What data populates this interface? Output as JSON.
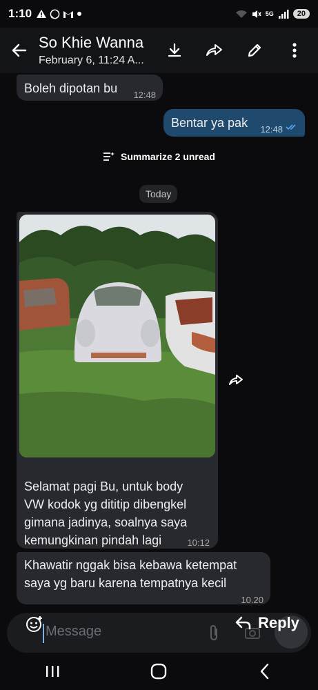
{
  "status_bar": {
    "time": "1:10",
    "network": "5G",
    "battery": "20"
  },
  "header": {
    "contact_name": "So Khie Wanna",
    "subtitle": "February 6, 11:24 A..."
  },
  "messages": {
    "m1": {
      "text": "Boleh dipotan bu",
      "time": "12:48"
    },
    "m2": {
      "text": "Bentar ya pak",
      "time": "12:48"
    },
    "summarize_label": "Summarize 2 unread",
    "date_divider": "Today",
    "m3": {
      "caption_lines": [
        "Selamat pagi Bu, untuk body",
        "VW kodok yg dititip dibengkel",
        "gimana jadinya, soalnya saya",
        "kemungkinan pindah lagi"
      ],
      "time": "10:12"
    },
    "m4": {
      "lines": [
        "Khawatir nggak bisa kebawa ketempat",
        "saya yg baru karena tempatnya kecil"
      ],
      "time": "10.20"
    }
  },
  "composer": {
    "placeholder": "Message",
    "reply_label": "Reply"
  },
  "colors": {
    "accent": "#2f8fe0",
    "outgoing_bubble": "#1f4a6e",
    "incoming_bubble": "#27292e"
  }
}
